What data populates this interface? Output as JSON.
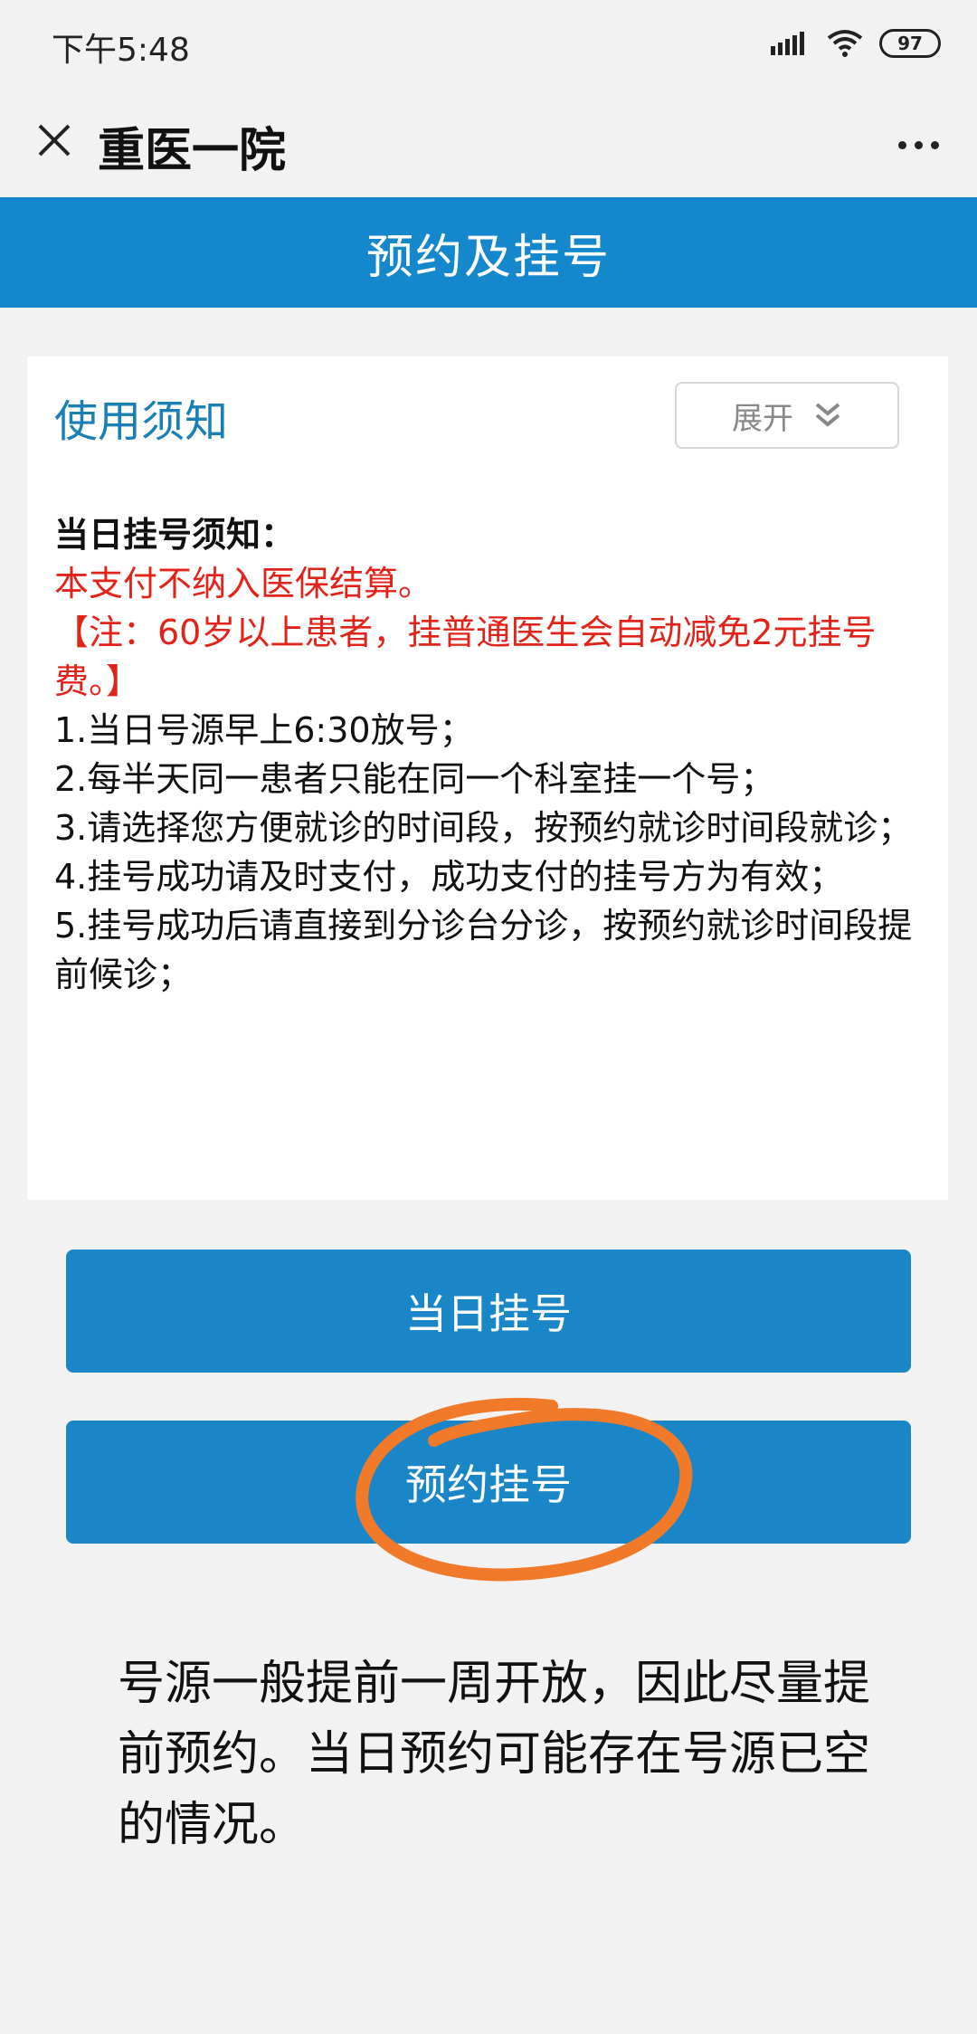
{
  "status_bar": {
    "time": "下午5:48",
    "battery": "97"
  },
  "title_bar": {
    "title": "重医一院"
  },
  "header": {
    "title": "预约及挂号"
  },
  "notice": {
    "title": "使用须知",
    "expand_label": "展开",
    "heading": "当日挂号须知：",
    "warning_lines": [
      "本支付不纳入医保结算。",
      "【注：60岁以上患者，挂普通医生会自动减免2元挂号费。】"
    ],
    "items": [
      "1.当日号源早上6:30放号；",
      "2.每半天同一患者只能在同一个科室挂一个号；",
      "3.请选择您方便就诊的时间段，按预约就诊时间段就诊；",
      "4.挂号成功请及时支付，成功支付的挂号方为有效；",
      "5.挂号成功后请直接到分诊台分诊，按预约就诊时间段提前候诊；"
    ]
  },
  "buttons": {
    "today": "当日挂号",
    "book": "预约挂号"
  },
  "annotation": {
    "note": "号源一般提前一周开放，因此尽量提前预约。当日预约可能存在号源已空的情况。",
    "circle_color": "#f07a2a"
  },
  "colors": {
    "header_blue": "#1587cc",
    "button_blue": "#1a86c8",
    "notice_title": "#1a7fb5",
    "warning_red": "#e2231a"
  }
}
